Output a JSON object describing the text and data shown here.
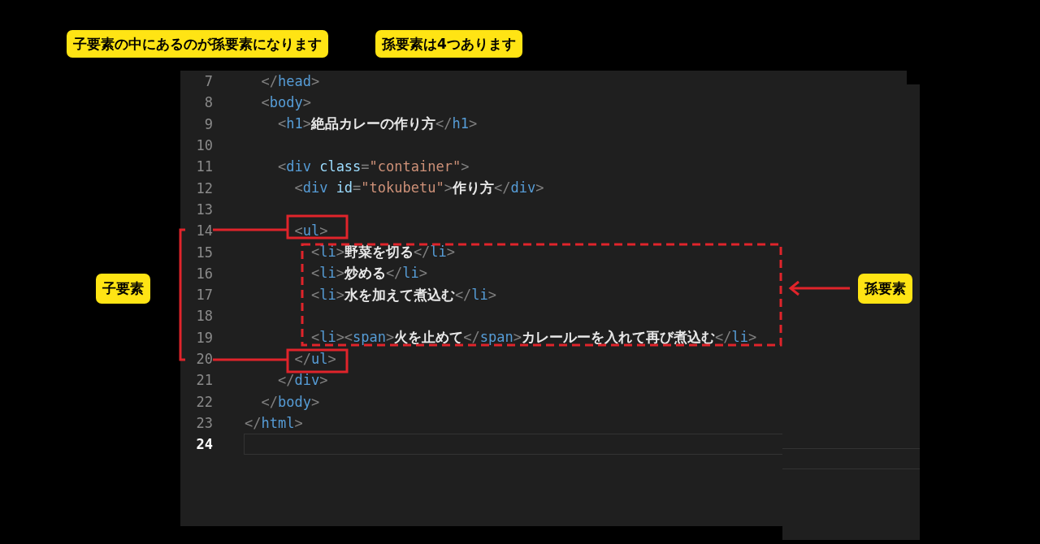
{
  "callouts_top": [
    {
      "text": "子要素の中にあるのが孫要素になります"
    },
    {
      "text": "孫要素は4つあります"
    }
  ],
  "editor": {
    "lines": [
      {
        "number": "7",
        "current": false,
        "tokens": [
          {
            "kind": "punct",
            "text": "  </"
          },
          {
            "kind": "tag",
            "text": "head"
          },
          {
            "kind": "punct",
            "text": ">"
          }
        ]
      },
      {
        "number": "8",
        "current": false,
        "tokens": [
          {
            "kind": "punct",
            "text": "  <"
          },
          {
            "kind": "tag",
            "text": "body"
          },
          {
            "kind": "punct",
            "text": ">"
          }
        ]
      },
      {
        "number": "9",
        "current": false,
        "tokens": [
          {
            "kind": "punct",
            "text": "    <"
          },
          {
            "kind": "tag",
            "text": "h1"
          },
          {
            "kind": "punct",
            "text": ">"
          },
          {
            "kind": "text",
            "text": "絶品カレーの作り方"
          },
          {
            "kind": "punct",
            "text": "</"
          },
          {
            "kind": "tag",
            "text": "h1"
          },
          {
            "kind": "punct",
            "text": ">"
          }
        ]
      },
      {
        "number": "10",
        "current": false
      },
      {
        "number": "11",
        "current": false,
        "tokens": [
          {
            "kind": "punct",
            "text": "    <"
          },
          {
            "kind": "tag",
            "text": "div"
          },
          {
            "kind": "attr",
            "text": " class"
          },
          {
            "kind": "punct",
            "text": "="
          },
          {
            "kind": "string",
            "text": "\"container\""
          },
          {
            "kind": "punct",
            "text": ">"
          }
        ]
      },
      {
        "number": "12",
        "current": false,
        "tokens": [
          {
            "kind": "punct",
            "text": "      <"
          },
          {
            "kind": "tag",
            "text": "div"
          },
          {
            "kind": "attr",
            "text": " id"
          },
          {
            "kind": "punct",
            "text": "="
          },
          {
            "kind": "string",
            "text": "\"tokubetu\""
          },
          {
            "kind": "punct",
            "text": ">"
          },
          {
            "kind": "text",
            "text": "作り方"
          },
          {
            "kind": "punct",
            "text": "</"
          },
          {
            "kind": "tag",
            "text": "div"
          },
          {
            "kind": "punct",
            "text": ">"
          }
        ]
      },
      {
        "number": "13",
        "current": false
      },
      {
        "number": "14",
        "current": false,
        "tokens": [
          {
            "kind": "punct",
            "text": "      <"
          },
          {
            "kind": "tag",
            "text": "ul"
          },
          {
            "kind": "punct",
            "text": ">"
          }
        ]
      },
      {
        "number": "15",
        "current": false,
        "tokens": [
          {
            "kind": "punct",
            "text": "        <"
          },
          {
            "kind": "tag",
            "text": "li"
          },
          {
            "kind": "punct",
            "text": ">"
          },
          {
            "kind": "text",
            "text": "野菜を切る"
          },
          {
            "kind": "punct",
            "text": "</"
          },
          {
            "kind": "tag",
            "text": "li"
          },
          {
            "kind": "punct",
            "text": ">"
          }
        ]
      },
      {
        "number": "16",
        "current": false,
        "tokens": [
          {
            "kind": "punct",
            "text": "        <"
          },
          {
            "kind": "tag",
            "text": "li"
          },
          {
            "kind": "punct",
            "text": ">"
          },
          {
            "kind": "text",
            "text": "炒める"
          },
          {
            "kind": "punct",
            "text": "</"
          },
          {
            "kind": "tag",
            "text": "li"
          },
          {
            "kind": "punct",
            "text": ">"
          }
        ]
      },
      {
        "number": "17",
        "current": false,
        "tokens": [
          {
            "kind": "punct",
            "text": "        <"
          },
          {
            "kind": "tag",
            "text": "li"
          },
          {
            "kind": "punct",
            "text": ">"
          },
          {
            "kind": "text",
            "text": "水を加えて煮込む"
          },
          {
            "kind": "punct",
            "text": "</"
          },
          {
            "kind": "tag",
            "text": "li"
          },
          {
            "kind": "punct",
            "text": ">"
          }
        ]
      },
      {
        "number": "18",
        "current": false
      },
      {
        "number": "19",
        "current": false,
        "tokens": [
          {
            "kind": "punct",
            "text": "        <"
          },
          {
            "kind": "tag",
            "text": "li"
          },
          {
            "kind": "punct",
            "text": "><"
          },
          {
            "kind": "tag",
            "text": "span"
          },
          {
            "kind": "punct",
            "text": ">"
          },
          {
            "kind": "text",
            "text": "火を止めて"
          },
          {
            "kind": "punct",
            "text": "</"
          },
          {
            "kind": "tag",
            "text": "span"
          },
          {
            "kind": "punct",
            "text": ">"
          },
          {
            "kind": "text",
            "text": "カレールーを入れて再び煮込む"
          },
          {
            "kind": "punct",
            "text": "</"
          },
          {
            "kind": "tag",
            "text": "li"
          },
          {
            "kind": "punct",
            "text": ">"
          }
        ]
      },
      {
        "number": "20",
        "current": false,
        "tokens": [
          {
            "kind": "punct",
            "text": "      </"
          },
          {
            "kind": "tag",
            "text": "ul"
          },
          {
            "kind": "punct",
            "text": ">"
          }
        ]
      },
      {
        "number": "21",
        "current": false,
        "tokens": [
          {
            "kind": "punct",
            "text": "    </"
          },
          {
            "kind": "tag",
            "text": "div"
          },
          {
            "kind": "punct",
            "text": ">"
          }
        ]
      },
      {
        "number": "22",
        "current": false,
        "tokens": [
          {
            "kind": "punct",
            "text": "  </"
          },
          {
            "kind": "tag",
            "text": "body"
          },
          {
            "kind": "punct",
            "text": ">"
          }
        ]
      },
      {
        "number": "23",
        "current": false,
        "tokens": [
          {
            "kind": "punct",
            "text": "</"
          },
          {
            "kind": "tag",
            "text": "html"
          },
          {
            "kind": "punct",
            "text": ">"
          }
        ]
      },
      {
        "number": "24",
        "current": true
      }
    ]
  },
  "labels": {
    "children": "子要素",
    "grandchildren": "孫要素"
  }
}
